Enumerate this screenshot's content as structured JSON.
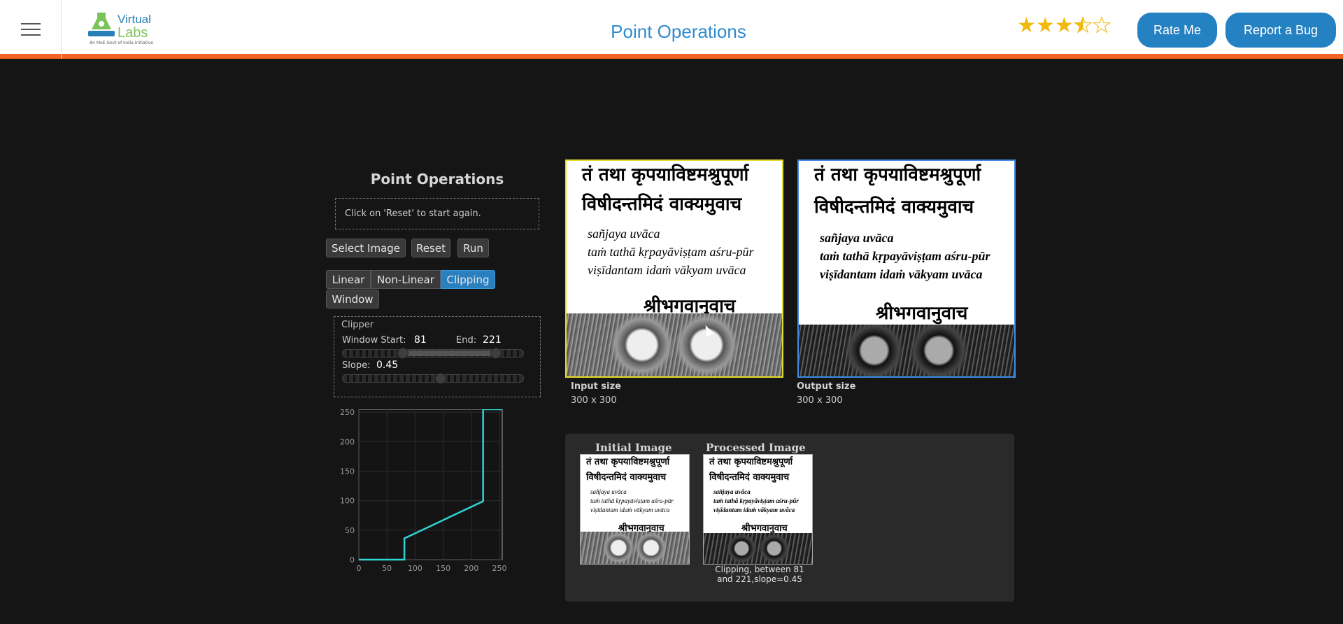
{
  "header": {
    "logo_word1": "Virtual",
    "logo_word2": "Labs",
    "logo_tagline": "An MoE Govt of India Initiative",
    "title": "Point Operations",
    "rating_stars": 3.5,
    "rate_label": "Rate Me",
    "bug_label": "Report a Bug"
  },
  "panel": {
    "title": "Point Operations",
    "message": "Click on 'Reset' to start again.",
    "buttons": {
      "select": "Select Image",
      "reset": "Reset",
      "run": "Run"
    },
    "tabs": [
      {
        "label": "Linear",
        "active": false
      },
      {
        "label": "Non-Linear",
        "active": false
      },
      {
        "label": "Clipping",
        "active": true
      },
      {
        "label": "Window",
        "active": false
      }
    ],
    "clipper": {
      "legend": "Clipper",
      "start_label": "Window Start:",
      "start_value": "81",
      "end_label": "End:",
      "end_value": "221",
      "slope_label": "Slope:",
      "slope_value": "0.45",
      "range_min": 0,
      "range_max": 255,
      "slope_fraction": 0.54
    }
  },
  "chart_data": {
    "type": "line",
    "x": [
      0,
      81,
      81,
      221,
      221,
      255
    ],
    "y": [
      0,
      0,
      36,
      99,
      255,
      255
    ],
    "xlim": [
      0,
      255
    ],
    "ylim": [
      0,
      255
    ],
    "xticks": [
      "0",
      "50",
      "100",
      "150",
      "200",
      "250"
    ],
    "yticks": [
      "0",
      "50",
      "100",
      "150",
      "200",
      "250"
    ],
    "color": "#2fd4d4",
    "grid": true
  },
  "images": {
    "input_caption": "Input size",
    "input_size": "300 x 300",
    "output_caption": "Output size",
    "output_size": "300 x 300",
    "deva_line1": "तं तथा कृपयाविष्टमश्रुपूर्णा",
    "deva_line2": "विषीदन्तमिदं वाक्यमुवाच",
    "roman_line1": "sañjaya uvāca",
    "roman_line2": "taṁ tathā kṛpayāviṣṭam aśru-pūr",
    "roman_line3": "viṣīdantam idaṁ vākyam uvāca",
    "deva_line3": "श्रीभगवानुवाच"
  },
  "history": {
    "initial_title": "Initial Image",
    "processed_title": "Processed Image",
    "processed_caption": "Clipping, between 81 and 221,slope=0.45"
  }
}
